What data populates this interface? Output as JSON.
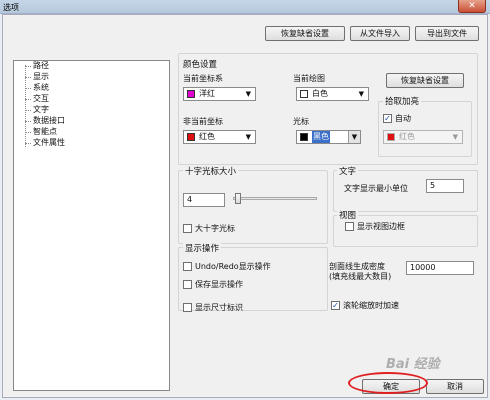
{
  "window": {
    "title": "选项",
    "close_icon": "close-icon"
  },
  "top_buttons": {
    "restore_defaults": "恢复缺省设置",
    "import_file": "从文件导入",
    "export_file": "导出到文件"
  },
  "tree": {
    "items": [
      "路径",
      "显示",
      "系统",
      "交互",
      "文字",
      "数据接口",
      "智能点",
      "文件属性"
    ]
  },
  "color_settings": {
    "title": "颜色设置",
    "current_axis": {
      "label": "当前坐标系",
      "value": "洋红",
      "swatch": "#e000d0"
    },
    "current_plot": {
      "label": "当前绘图",
      "value": "白色",
      "swatch": "#ffffff"
    },
    "restore_defaults": "恢复缺省设置",
    "noncurrent_axis": {
      "label": "非当前坐标",
      "value": "红色",
      "swatch": "#e01010"
    },
    "cursor": {
      "label": "光标",
      "value": "黑色",
      "swatch": "#000000"
    },
    "pick_highlight": {
      "title": "拾取加亮",
      "auto_label": "自动",
      "auto_checked": true,
      "color_value": "红色",
      "color_swatch": "#e01010"
    }
  },
  "crosshair": {
    "title": "十字光标大小",
    "value": "4",
    "large_label": "大十字光标",
    "large_checked": false
  },
  "text_group": {
    "title": "文字",
    "min_unit_label": "文字显示最小单位",
    "min_unit_value": "5"
  },
  "view_group": {
    "title": "视图",
    "show_border_label": "显示视图边框",
    "show_border_checked": false
  },
  "display_ops": {
    "title": "显示操作",
    "undo_redo_label": "Undo/Redo显示操作",
    "undo_redo_checked": false,
    "save_label": "保存显示操作",
    "save_checked": false
  },
  "section_density": {
    "label_line1": "剖面线生成密度",
    "label_line2": "(填充线最大数目)",
    "value": "10000"
  },
  "show_dimension": {
    "label": "显示尺寸标识",
    "checked": false
  },
  "wheel_zoom": {
    "label": "滚轮缩放时加速",
    "checked": true
  },
  "bottom": {
    "ok": "确定",
    "cancel": "取消"
  },
  "watermark": "Bai 经验"
}
